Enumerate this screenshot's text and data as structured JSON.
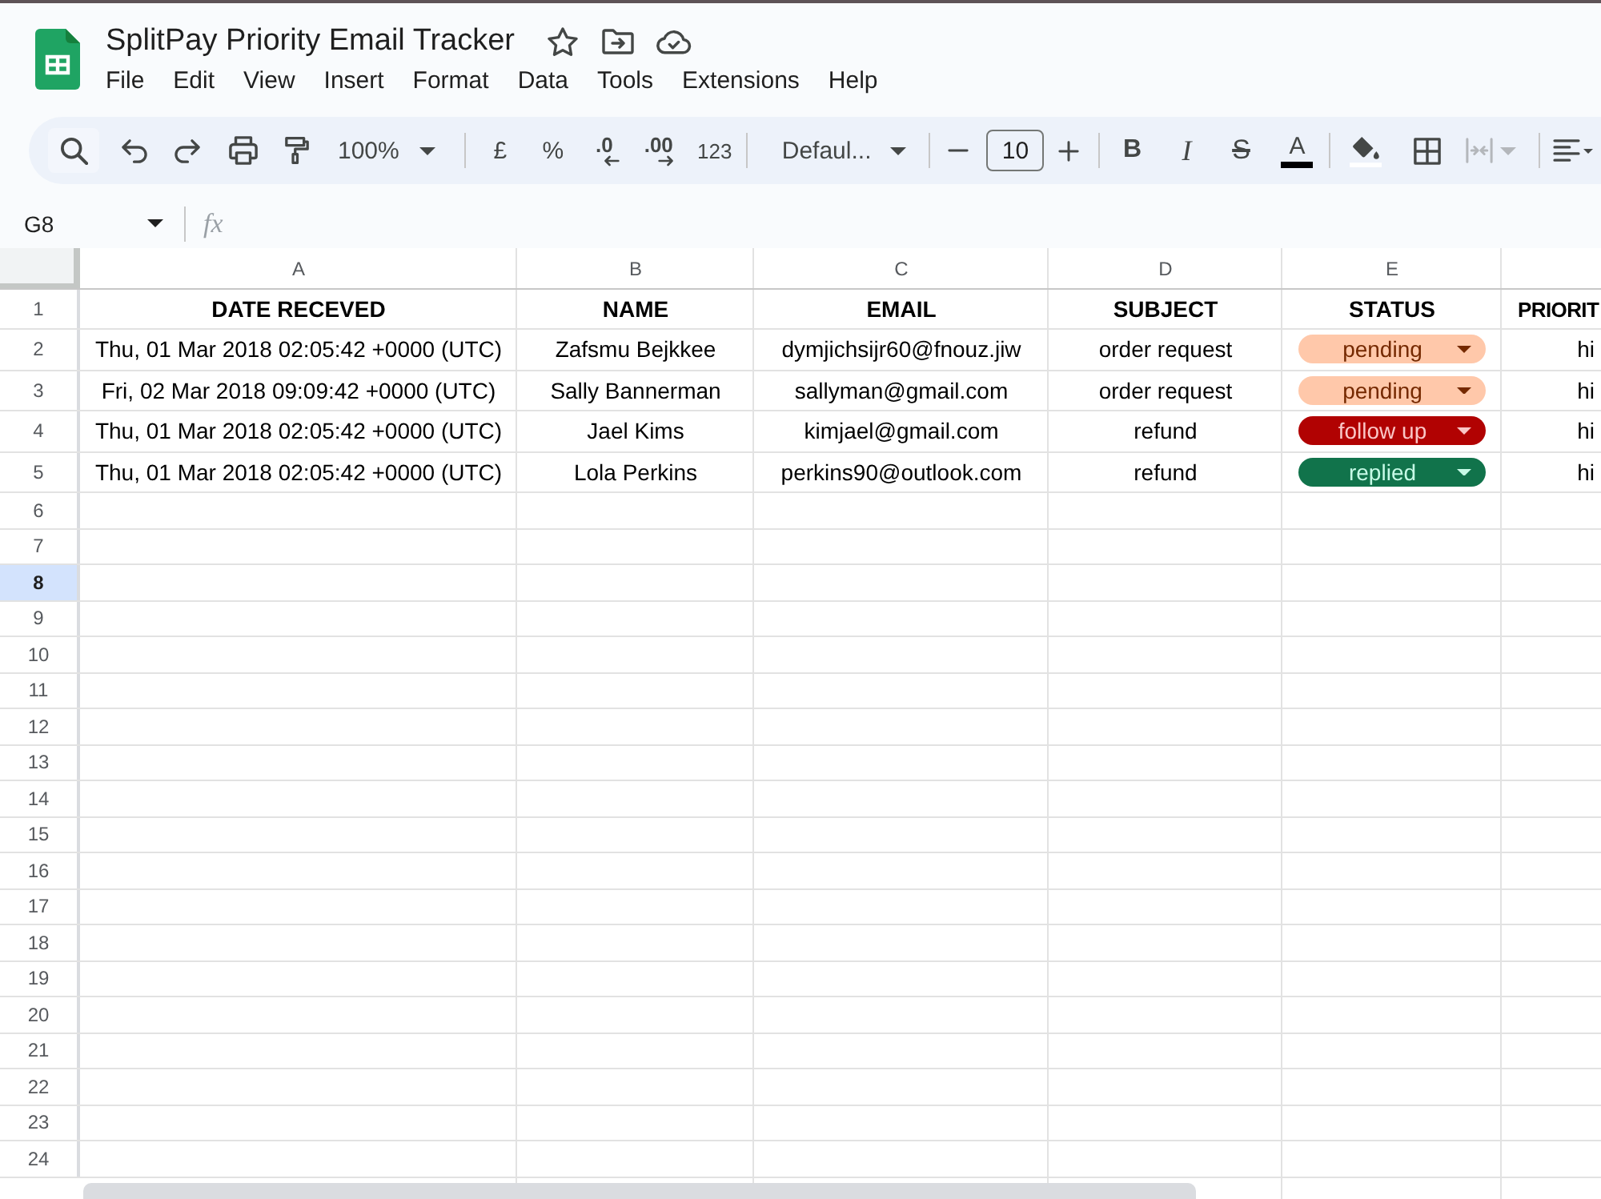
{
  "app": {
    "title": "SplitPay Priority Email Tracker",
    "menu": [
      "File",
      "Edit",
      "View",
      "Insert",
      "Format",
      "Data",
      "Tools",
      "Extensions",
      "Help"
    ]
  },
  "toolbar": {
    "zoom": "100%",
    "currency": "£",
    "percent": "%",
    "decrease_decimals": ".0",
    "increase_decimals": ".00",
    "number_format": "123",
    "font": "Defaul...",
    "font_size": "10",
    "bold": "B",
    "italic": "I",
    "strikethrough": "S",
    "text_color": "A",
    "merge_cells": {
      "disabled": true
    }
  },
  "formula_bar": {
    "cell_reference": "G8",
    "function_label": "fx"
  },
  "sheet": {
    "columns": [
      "A",
      "B",
      "C",
      "D",
      "E"
    ],
    "rows": [
      {
        "number": "1",
        "selected": false,
        "cells": [
          {
            "kind": "header",
            "text": "DATE RECEVED"
          },
          {
            "kind": "header",
            "text": "NAME"
          },
          {
            "kind": "header",
            "text": "EMAIL"
          },
          {
            "kind": "header",
            "text": "SUBJECT"
          },
          {
            "kind": "header",
            "text": "STATUS"
          },
          {
            "kind": "header",
            "text": "PRIORIT"
          }
        ]
      },
      {
        "number": "2",
        "selected": false,
        "cells": [
          {
            "kind": "text",
            "text": "Thu, 01 Mar 2018 02:05:42 +0000 (UTC)"
          },
          {
            "kind": "text",
            "text": "Zafsmu Bejkkee"
          },
          {
            "kind": "text",
            "text": "dymjichsijr60@fnouz.jiw"
          },
          {
            "kind": "text",
            "text": "order request"
          },
          {
            "kind": "chip",
            "text": "pending",
            "color": "#ffc8aa"
          },
          {
            "kind": "text",
            "text": "hi"
          }
        ]
      },
      {
        "number": "3",
        "selected": false,
        "cells": [
          {
            "kind": "text",
            "text": "Fri, 02 Mar 2018 09:09:42 +0000 (UTC)"
          },
          {
            "kind": "text",
            "text": "Sally Bannerman"
          },
          {
            "kind": "text",
            "text": "sallyman@gmail.com"
          },
          {
            "kind": "text",
            "text": "order request"
          },
          {
            "kind": "chip",
            "text": "pending",
            "color": "#ffc8aa"
          },
          {
            "kind": "text",
            "text": "hi"
          }
        ]
      },
      {
        "number": "4",
        "selected": false,
        "cells": [
          {
            "kind": "text",
            "text": "Thu, 01 Mar 2018 02:05:42 +0000 (UTC)"
          },
          {
            "kind": "text",
            "text": "Jael Kims"
          },
          {
            "kind": "text",
            "text": "kimjael@gmail.com"
          },
          {
            "kind": "text",
            "text": "refund"
          },
          {
            "kind": "chip",
            "text": "follow up",
            "color": "#b10202"
          },
          {
            "kind": "text",
            "text": "hi"
          }
        ]
      },
      {
        "number": "5",
        "selected": false,
        "cells": [
          {
            "kind": "text",
            "text": "Thu, 01 Mar 2018 02:05:42 +0000 (UTC)"
          },
          {
            "kind": "text",
            "text": "Lola Perkins"
          },
          {
            "kind": "text",
            "text": "perkins90@outlook.com"
          },
          {
            "kind": "text",
            "text": "refund"
          },
          {
            "kind": "chip",
            "text": "replied",
            "color": "#11734b"
          },
          {
            "kind": "text",
            "text": "hi"
          }
        ]
      },
      {
        "number": "6",
        "selected": false
      },
      {
        "number": "7",
        "selected": false
      },
      {
        "number": "8",
        "selected": true
      },
      {
        "number": "9",
        "selected": false
      },
      {
        "number": "10",
        "selected": false
      },
      {
        "number": "11",
        "selected": false
      },
      {
        "number": "12",
        "selected": false
      },
      {
        "number": "13",
        "selected": false
      },
      {
        "number": "14",
        "selected": false
      },
      {
        "number": "15",
        "selected": false
      },
      {
        "number": "16",
        "selected": false
      },
      {
        "number": "17",
        "selected": false
      },
      {
        "number": "18",
        "selected": false
      },
      {
        "number": "19",
        "selected": false
      },
      {
        "number": "20",
        "selected": false
      },
      {
        "number": "21",
        "selected": false
      },
      {
        "number": "22",
        "selected": false
      },
      {
        "number": "23",
        "selected": false
      },
      {
        "number": "24",
        "selected": false
      }
    ]
  }
}
